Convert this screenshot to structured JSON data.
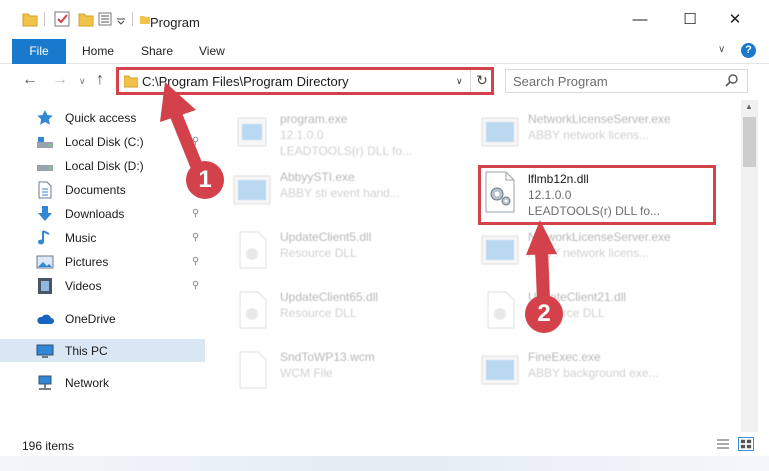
{
  "window": {
    "title": "Program",
    "minimize_glyph": "—",
    "maximize_glyph": "☐",
    "close_glyph": "✕"
  },
  "ribbon": {
    "file": "File",
    "home": "Home",
    "share": "Share",
    "view": "View",
    "help_glyph": "?"
  },
  "navigation": {
    "address": "C:\\Program Files\\Program Directory",
    "search_placeholder": "Search Program"
  },
  "sidebar": {
    "items": [
      {
        "label": "Quick access",
        "icon": "star-icon"
      },
      {
        "label": "Local Disk (C:)",
        "icon": "drive-icon"
      },
      {
        "label": "Local Disk (D:)",
        "icon": "drive-icon"
      },
      {
        "label": "Documents",
        "icon": "documents-icon"
      },
      {
        "label": "Downloads",
        "icon": "downloads-icon"
      },
      {
        "label": "Music",
        "icon": "music-icon"
      },
      {
        "label": "Pictures",
        "icon": "pictures-icon"
      },
      {
        "label": "Videos",
        "icon": "videos-icon"
      },
      {
        "label": "OneDrive",
        "icon": "cloud-icon"
      },
      {
        "label": "This PC",
        "icon": "pc-icon"
      },
      {
        "label": "Network",
        "icon": "network-icon"
      }
    ]
  },
  "files": {
    "program": {
      "name": "program.exe",
      "sub1": "12.1.0.0",
      "sub2": "LEADTOOLS(r) DLL fo..."
    },
    "networklicense1": {
      "name": "NetworkLicenseServer.exe",
      "sub1": "ABBY network licens..."
    },
    "abbyy": {
      "name": "AbbyySTI.exe",
      "sub1": "ABBY sti event hand..."
    },
    "target": {
      "name": "lflmb12n.dll",
      "sub1": "12.1.0.0",
      "sub2": "LEADTOOLS(r) DLL fo..."
    },
    "update5": {
      "name": "UpdateClient5.dll",
      "sub1": "Resource DLL"
    },
    "networklicense2": {
      "name": "NetworkLicenseServer.exe",
      "sub1": "ABBY network licens..."
    },
    "update65": {
      "name": "UpdateClient65.dll",
      "sub1": "Resource DLL"
    },
    "update21": {
      "name": "UpdateClient21.dll",
      "sub1": "Resource DLL"
    },
    "sndto": {
      "name": "SndToWP13.wcm",
      "sub1": "WCM File"
    },
    "fineexec": {
      "name": "FineExec.exe",
      "sub1": "ABBY background exe..."
    }
  },
  "status": {
    "count": "196 items"
  },
  "callouts": {
    "one": "1",
    "two": "2"
  },
  "colors": {
    "accent": "#1979ca",
    "highlight_red": "#d3414b",
    "selected_bg": "#d9e7f4"
  }
}
